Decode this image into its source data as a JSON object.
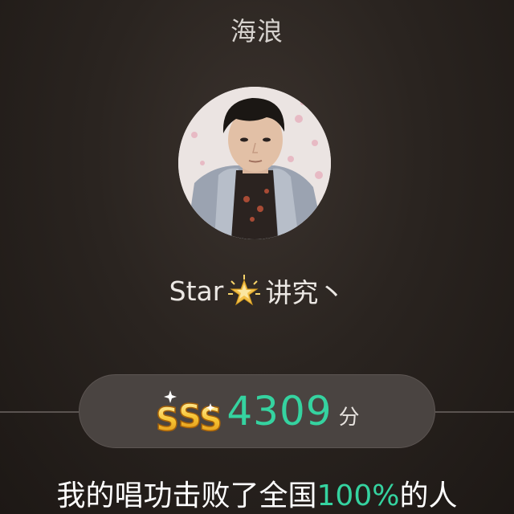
{
  "song": {
    "title": "海浪"
  },
  "user": {
    "name_prefix": "Star",
    "name_suffix": "讲究丶",
    "avatar_icon": "user-photo-avatar",
    "name_icon": "sparkle-star-icon"
  },
  "score": {
    "grade_icon": "sss-grade-badge",
    "grade_text": "SSS",
    "value": "4309",
    "unit": "分"
  },
  "result": {
    "prefix": "我的唱功击败了全国",
    "percent": "100%",
    "suffix": "的人"
  },
  "colors": {
    "accent": "#35d3a0",
    "background": "#2a2420",
    "pill": "#4a4441",
    "gold": "#f4b400"
  }
}
